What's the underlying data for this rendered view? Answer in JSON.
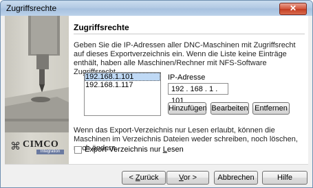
{
  "window": {
    "title": "Zugriffsrechte",
    "close_glyph": "✕"
  },
  "page": {
    "heading": "Zugriffsrechte",
    "description": "Geben Sie die IP-Adressen aller DNC-Maschinen mit Zugriffsrecht auf dieses Exportverzeichnis ein. Wenn die Liste keine Einträge enthält, haben alle Maschinen/Rechner mit NFS-Software Zugriffsrecht."
  },
  "logo": {
    "mark": "⌘",
    "brand": "CIMCO",
    "sub": "Integration"
  },
  "ip_list": {
    "items": [
      "192.168.1.101",
      "192.168.1.117"
    ],
    "selected_index": 0
  },
  "ip_field": {
    "label": "IP-Adresse",
    "value": "192 . 168 .   1  . 101"
  },
  "buttons": {
    "add": "Hinzufügen",
    "edit": "Bearbeiten",
    "remove": "Entfernen"
  },
  "note": "Wenn das Export-Verzeichnis nur Lesen erlaubt, können die Maschinen im Verzeichnis Dateien weder schreiben, noch löschen, noch ändern.",
  "readonly_checkbox": {
    "label_pre": "Export-Verzeichnis nur ",
    "label_accel": "L",
    "label_post": "esen",
    "checked": false
  },
  "footer": {
    "back_pre": "< ",
    "back_accel": "Z",
    "back_post": "urück",
    "next_accel": "V",
    "next_post": "or >",
    "cancel": "Abbrechen",
    "help": "Hilfe"
  },
  "colors": {
    "selection": "#bfd9f5",
    "close_button": "#c94a30",
    "titlebar": "#b4cbe4"
  }
}
